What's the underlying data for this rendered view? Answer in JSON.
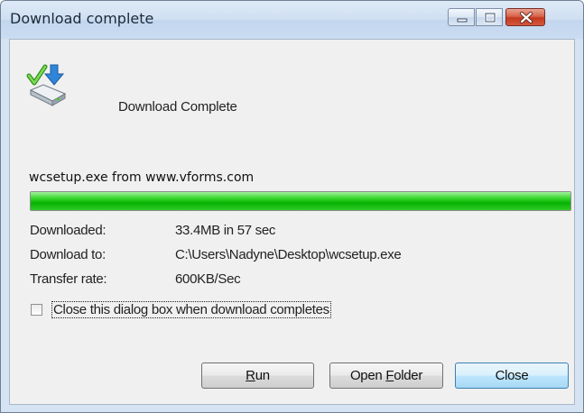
{
  "window": {
    "title": "Download complete",
    "controls": {
      "minimize_icon": "minimize-icon",
      "maximize_icon": "maximize-icon",
      "close_icon": "close-icon"
    }
  },
  "header": {
    "icon": "download-complete-icon",
    "text": "Download Complete"
  },
  "download": {
    "source": "wcsetup.exe from www.vforms.com",
    "progress_fraction": 1.0,
    "progress_color": "#06b302",
    "info": [
      {
        "label": "Downloaded:",
        "value": "33.4MB in 57 sec"
      },
      {
        "label": "Download to:",
        "value": "C:\\Users\\Nadyne\\Desktop\\wcsetup.exe"
      },
      {
        "label": "Transfer rate:",
        "value": "600KB/Sec"
      }
    ]
  },
  "option": {
    "checked": false,
    "label": "Close this dialog box when download completes"
  },
  "buttons": {
    "run": {
      "mnemonic": "R",
      "rest": "un"
    },
    "open_folder": {
      "prefix": "Open ",
      "mnemonic": "F",
      "rest": "older"
    },
    "close": "Close"
  }
}
